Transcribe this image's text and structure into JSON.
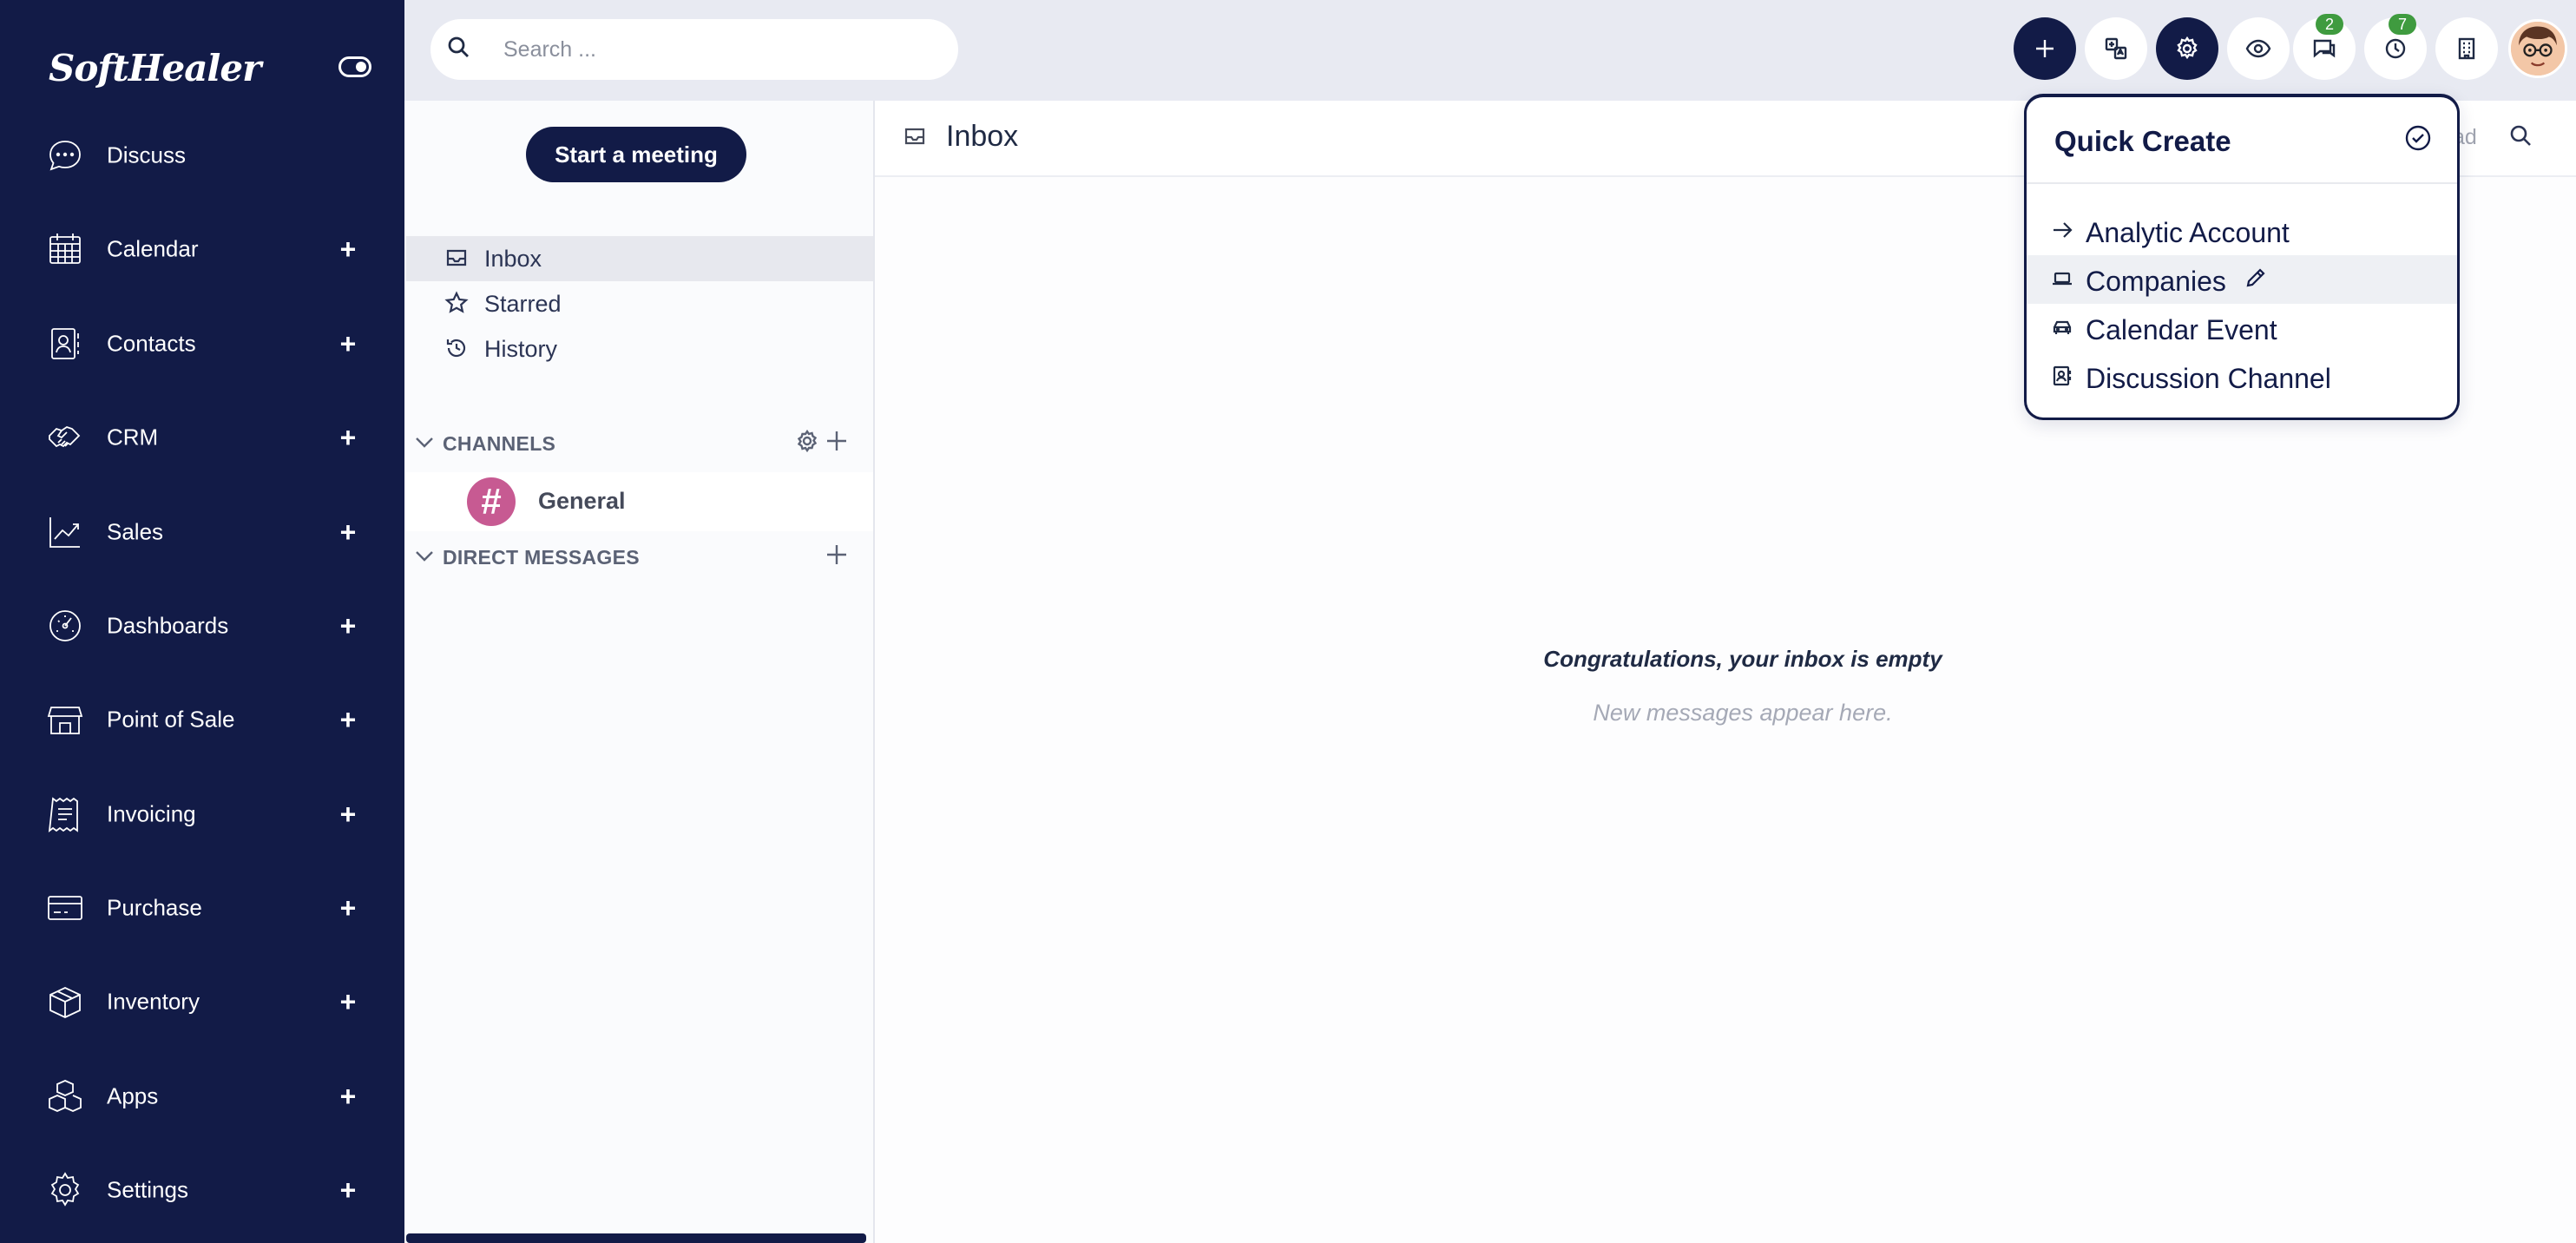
{
  "brand": {
    "logo_text": "SoftHealer"
  },
  "sidebar": {
    "items": [
      {
        "label": "Discuss",
        "icon": "chat-bubble-icon",
        "has_add": false
      },
      {
        "label": "Calendar",
        "icon": "calendar-icon",
        "has_add": true
      },
      {
        "label": "Contacts",
        "icon": "contacts-icon",
        "has_add": true
      },
      {
        "label": "CRM",
        "icon": "handshake-icon",
        "has_add": true
      },
      {
        "label": "Sales",
        "icon": "trend-chart-icon",
        "has_add": true
      },
      {
        "label": "Dashboards",
        "icon": "gauge-icon",
        "has_add": true
      },
      {
        "label": "Point of Sale",
        "icon": "store-icon",
        "has_add": true
      },
      {
        "label": "Invoicing",
        "icon": "receipt-icon",
        "has_add": true
      },
      {
        "label": "Purchase",
        "icon": "credit-card-icon",
        "has_add": true
      },
      {
        "label": "Inventory",
        "icon": "box-icon",
        "has_add": true
      },
      {
        "label": "Apps",
        "icon": "cubes-icon",
        "has_add": true
      },
      {
        "label": "Settings",
        "icon": "gear-icon",
        "has_add": true
      }
    ],
    "add_symbol": "+"
  },
  "topbar": {
    "search_placeholder": "Search ...",
    "messages_badge": "2",
    "activities_badge": "7"
  },
  "discuss": {
    "start_meeting_label": "Start a meeting",
    "mailboxes": [
      {
        "label": "Inbox",
        "active": true
      },
      {
        "label": "Starred",
        "active": false
      },
      {
        "label": "History",
        "active": false
      }
    ],
    "channels_header": "CHANNELS",
    "channels": [
      {
        "name": "General",
        "symbol": "#"
      }
    ],
    "direct_messages_header": "DIRECT MESSAGES"
  },
  "main": {
    "title": "Inbox",
    "mark_read_partial": "ad",
    "empty_title": "Congratulations, your inbox is empty",
    "empty_subtitle": "New messages appear here."
  },
  "quick_create": {
    "title": "Quick Create",
    "items": [
      {
        "label": "Analytic Account",
        "icon": "arrow-right-icon"
      },
      {
        "label": "Companies",
        "icon": "laptop-icon",
        "hovered": true
      },
      {
        "label": "Calendar Event",
        "icon": "car-icon"
      },
      {
        "label": "Discussion Channel",
        "icon": "contact-card-icon"
      }
    ]
  },
  "colors": {
    "sidebar_bg": "#121b47",
    "topbar_bg": "#e8eaf2",
    "badge_green": "#3f9b3f",
    "channel_avatar": "#c75a92"
  }
}
